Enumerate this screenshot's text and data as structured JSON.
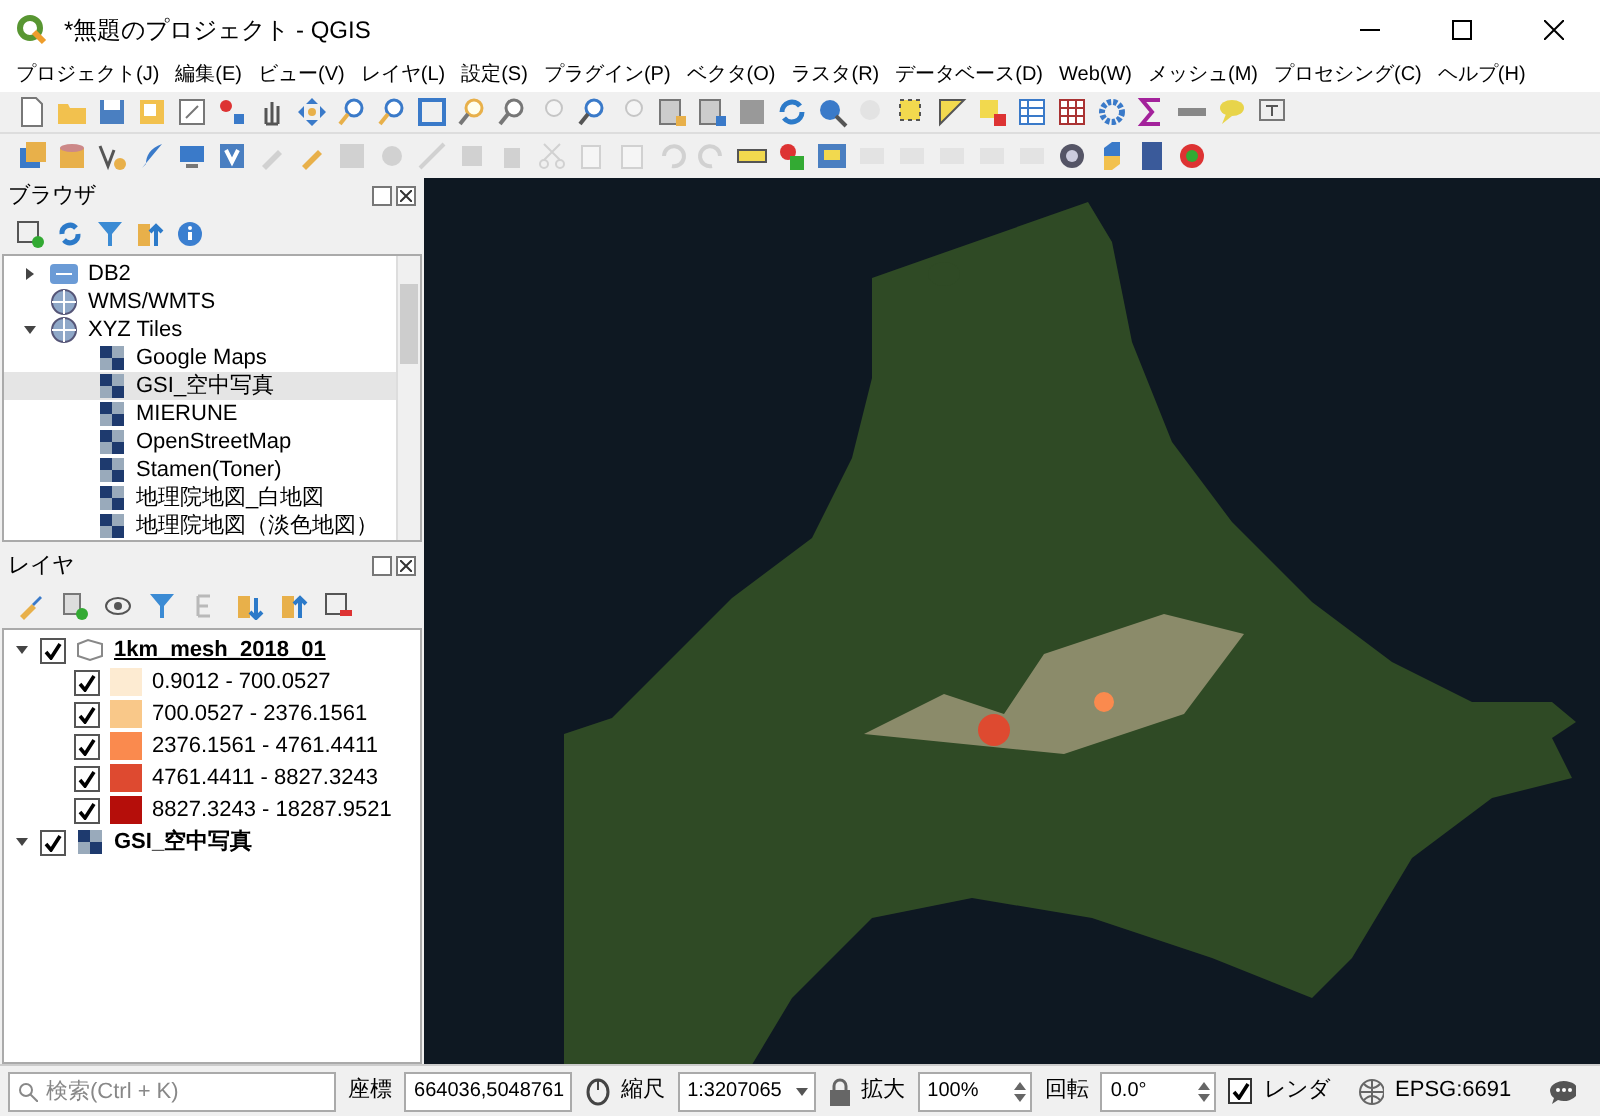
{
  "window": {
    "title": "*無題のプロジェクト - QGIS"
  },
  "menu": [
    {
      "label": "プロジェクト(J)"
    },
    {
      "label": "編集(E)"
    },
    {
      "label": "ビュー(V)"
    },
    {
      "label": "レイヤ(L)"
    },
    {
      "label": "設定(S)"
    },
    {
      "label": "プラグイン(P)"
    },
    {
      "label": "ベクタ(O)"
    },
    {
      "label": "ラスタ(R)"
    },
    {
      "label": "データベース(D)"
    },
    {
      "label": "Web(W)"
    },
    {
      "label": "メッシュ(M)"
    },
    {
      "label": "プロセシング(C)"
    },
    {
      "label": "ヘルプ(H)"
    }
  ],
  "browser": {
    "title": "ブラウザ",
    "items": [
      {
        "label": "DB2",
        "kind": "db",
        "expanded": false,
        "selected": false
      },
      {
        "label": "WMS/WMTS",
        "kind": "globe",
        "selected": false
      },
      {
        "label": "XYZ Tiles",
        "kind": "globe",
        "expanded": true,
        "selected": false,
        "children": [
          {
            "label": "Google Maps",
            "kind": "tiles",
            "selected": false
          },
          {
            "label": "GSI_空中写真",
            "kind": "tiles",
            "selected": true
          },
          {
            "label": "MIERUNE",
            "kind": "tiles",
            "selected": false
          },
          {
            "label": "OpenStreetMap",
            "kind": "tiles",
            "selected": false
          },
          {
            "label": "Stamen(Toner)",
            "kind": "tiles",
            "selected": false
          },
          {
            "label": "地理院地図_白地図",
            "kind": "tiles",
            "selected": false
          },
          {
            "label": "地理院地図（淡色地図）",
            "kind": "tiles",
            "selected": false
          }
        ]
      }
    ]
  },
  "layers": {
    "title": "レイヤ",
    "items": [
      {
        "label": "1km_mesh_2018_01",
        "kind": "polygon",
        "checked": true,
        "expanded": true,
        "selected": true,
        "classes": [
          {
            "label": "0.9012 - 700.0527",
            "checked": true,
            "color": "#fdebd2"
          },
          {
            "label": "700.0527 - 2376.1561",
            "checked": true,
            "color": "#f9c889"
          },
          {
            "label": "2376.1561 - 4761.4411",
            "checked": true,
            "color": "#fa8a4e"
          },
          {
            "label": "4761.4411 - 8827.3243",
            "checked": true,
            "color": "#de4a30"
          },
          {
            "label": "8827.3243 - 18287.9521",
            "checked": true,
            "color": "#b50e0a"
          }
        ]
      },
      {
        "label": "GSI_空中写真",
        "kind": "raster",
        "checked": true,
        "expanded": true,
        "selected": false
      }
    ]
  },
  "status_bar": {
    "search": {
      "placeholder": "検索(Ctrl + K)"
    },
    "coordinate_label": "座標",
    "coordinate": "664036,5048761",
    "scale_label": "縮尺",
    "scale": "1:3207065",
    "magnifier_label": "拡大",
    "magnifier": "100%",
    "rotation_label": "回転",
    "rotation": "0.0°",
    "render": {
      "label": "レンダ",
      "checked": true
    },
    "crs": "EPSG:6691"
  }
}
